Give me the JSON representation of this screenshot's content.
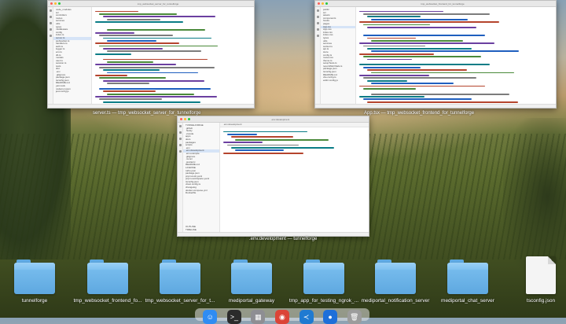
{
  "windows": [
    {
      "id": "server",
      "caption": "server.ts — tmp_websocket_server_for_tunnelforge",
      "title": "tmp_websocket_server_for_tunnelforge",
      "sidebar_items": [
        "node_modules",
        "src",
        "controllers",
        "routes",
        "services",
        "utils",
        "types",
        "middleware",
        "config",
        "index.ts",
        "server.ts",
        "websocket.ts",
        "handlers.ts",
        "auth.ts",
        "logger.ts",
        "env.ts",
        "db.ts",
        "models",
        "user.ts",
        "session.ts",
        "tests",
        "dist",
        ".env",
        ".gitignore",
        "package.json",
        "tsconfig.json",
        "README.md",
        "yarn.lock",
        "nodemon.json",
        "jest.config.js"
      ],
      "active_index": 10
    },
    {
      "id": "frontend",
      "caption": "App.tsx — tmp_websocket_frontend_for_tunnelforge",
      "title": "tmp_websocket_frontend_for_tunnelforge",
      "sidebar_items": [
        "public",
        "src",
        "assets",
        "components",
        "hooks",
        "pages",
        "App.tsx",
        "App.css",
        "index.tsx",
        "index.css",
        "types",
        "utils",
        "services",
        "socket.ts",
        "api.ts",
        "store",
        "config.ts",
        "routes.tsx",
        "theme.ts",
        "setupTests.ts",
        "reportWebVitals.ts",
        "package.json",
        "tsconfig.json",
        "README.md",
        "vite.config.ts",
        "eslint.config.js"
      ],
      "active_index": 6
    },
    {
      "id": "env",
      "caption": ".env.development — tunnelforge",
      "title": ".env.development",
      "sidebar_items": [
        "TUNNELFORGE",
        ".github",
        ".husky",
        ".vscode",
        "apps",
        "docs",
        "packages",
        "scripts",
        ".env",
        ".env.development",
        ".env.example",
        ".gitignore",
        ".nvmrc",
        ".prettierrc",
        "README.md",
        "LICENSE",
        "turbo.json",
        "package.json",
        "pnpm-lock.yaml",
        "pnpm-workspace.yaml",
        "tsconfig.json",
        "vitest.config.ts",
        "changelog",
        "docker-compose.yml",
        "Dockerfile"
      ],
      "active_index": 9,
      "outline_label": "OUTLINE",
      "timeline_label": "TIMELINE"
    }
  ],
  "desktop_items": [
    {
      "label": "tunnelforge",
      "kind": "folder"
    },
    {
      "label": "tmp_websocket_frontend_fo...",
      "kind": "folder"
    },
    {
      "label": "tmp_websocket_server_for_t...",
      "kind": "folder"
    },
    {
      "label": "mediportal_gateway",
      "kind": "folder"
    },
    {
      "label": "tmp_app_for_testing_ngrok_...",
      "kind": "folder"
    },
    {
      "label": "mediportal_notification_server",
      "kind": "folder"
    },
    {
      "label": "mediportal_chat_server",
      "kind": "folder"
    },
    {
      "label": "tsconfig.json",
      "kind": "file"
    }
  ],
  "dock_apps": [
    {
      "name": "finder",
      "icon": "finder-icon",
      "color": "#2f8cf2",
      "glyph": "☺"
    },
    {
      "name": "terminal",
      "icon": "terminal-icon",
      "color": "#2b2b2b",
      "glyph": ">_"
    },
    {
      "name": "launchpad",
      "icon": "launchpad-icon",
      "color": "#8e8e93",
      "glyph": "▦"
    },
    {
      "name": "chrome",
      "icon": "chrome-icon",
      "color": "#db4437",
      "glyph": "◉"
    },
    {
      "name": "vscode",
      "icon": "vscode-icon",
      "color": "#1f7ad1",
      "glyph": "≺"
    },
    {
      "name": "browser",
      "icon": "browser-icon",
      "color": "#1e6fd9",
      "glyph": "●"
    },
    {
      "name": "trash",
      "icon": "trash-icon",
      "color": "#9c9c9c",
      "glyph": "🗑"
    }
  ]
}
